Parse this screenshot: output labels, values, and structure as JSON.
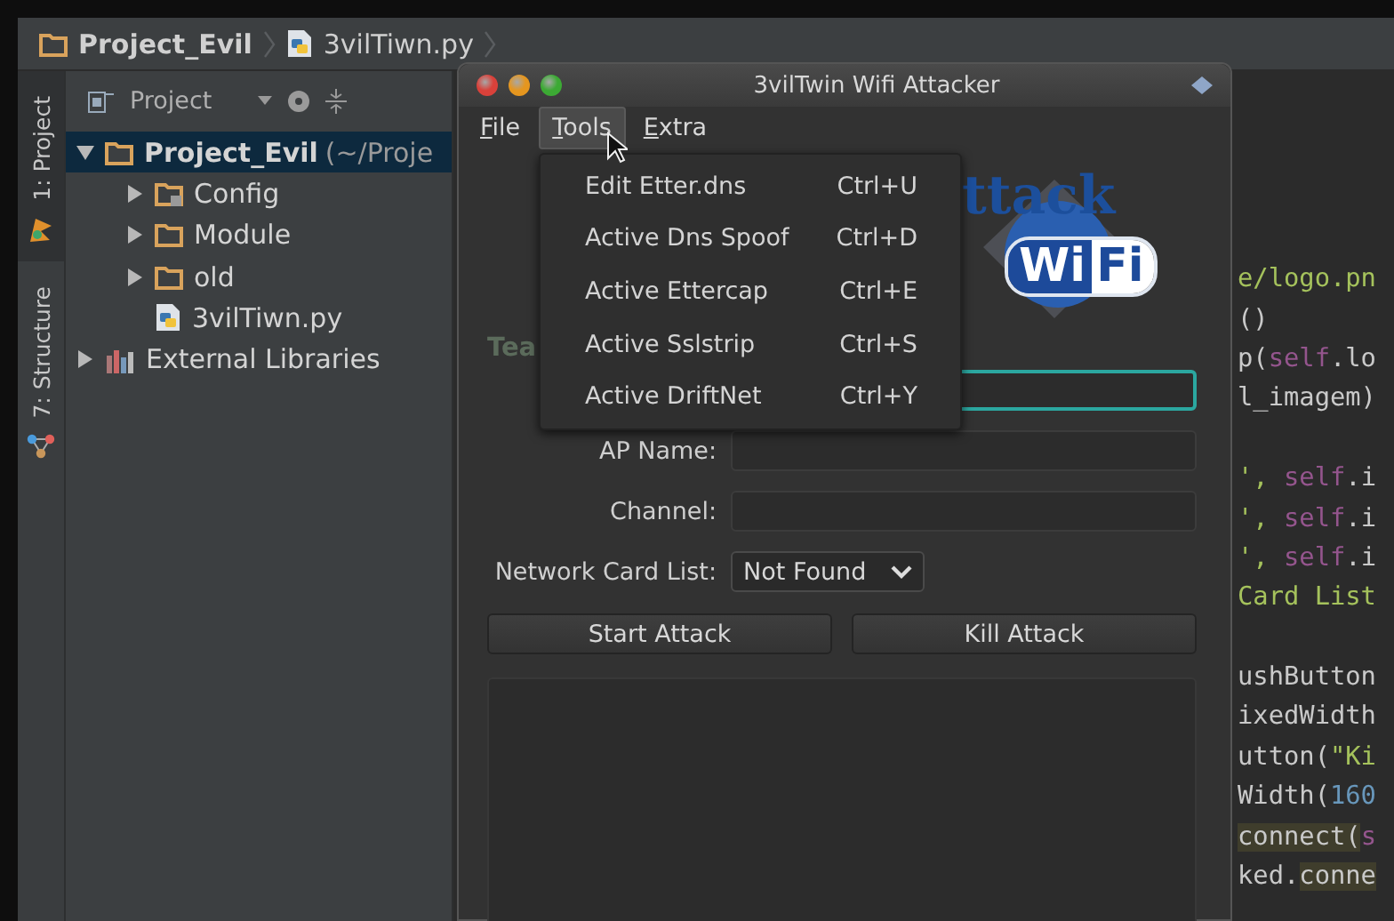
{
  "breadcrumb": [
    {
      "label": "Project_Evil",
      "kind": "folder"
    },
    {
      "label": "3vilTiwn.py",
      "kind": "python"
    }
  ],
  "tool_rail": [
    {
      "label": "1: Project",
      "kind": "project",
      "selected": true
    },
    {
      "label": "7: Structure",
      "kind": "structure",
      "selected": false
    }
  ],
  "project_panel": {
    "title": "Project",
    "tree": [
      {
        "label": "Project_Evil",
        "path": "(~/Proje",
        "kind": "folder",
        "expanded": true,
        "selected": true,
        "children": [
          {
            "label": "Config",
            "kind": "config",
            "expanded": false,
            "selected": false
          },
          {
            "label": "Module",
            "kind": "folder",
            "expanded": false,
            "selected": false
          },
          {
            "label": "old",
            "kind": "folder",
            "expanded": false,
            "selected": false
          },
          {
            "label": "3vilTiwn.py",
            "kind": "python",
            "selected": false
          }
        ]
      },
      {
        "label": "External Libraries",
        "kind": "libraries",
        "expanded": false,
        "selected": false
      }
    ]
  },
  "code_blocks": [
    [
      [
        {
          "text": "e/logo.pn",
          "kind": "string"
        }
      ],
      [
        {
          "text": "()",
          "kind": "plain"
        }
      ],
      [
        {
          "text": "p(",
          "kind": "plain"
        },
        {
          "text": "self",
          "kind": "self"
        },
        {
          "text": ".lo",
          "kind": "plain"
        }
      ],
      [
        {
          "text": "l_imagem)",
          "kind": "plain"
        }
      ]
    ],
    [
      [
        {
          "text": "', ",
          "kind": "string"
        },
        {
          "text": "self",
          "kind": "self"
        },
        {
          "text": ".i",
          "kind": "plain"
        }
      ],
      [
        {
          "text": "', ",
          "kind": "string"
        },
        {
          "text": "self",
          "kind": "self"
        },
        {
          "text": ".i",
          "kind": "plain"
        }
      ],
      [
        {
          "text": "', ",
          "kind": "string"
        },
        {
          "text": "self",
          "kind": "self"
        },
        {
          "text": ".i",
          "kind": "plain"
        }
      ],
      [
        {
          "text": "Card List",
          "kind": "string"
        }
      ]
    ],
    [
      [
        {
          "text": "ushButton",
          "kind": "plain"
        }
      ],
      [
        {
          "text": "ixedWidth",
          "kind": "plain"
        }
      ],
      [
        {
          "text": "utton(",
          "kind": "plain"
        },
        {
          "text": "\"Ki",
          "kind": "string"
        }
      ],
      [
        {
          "text": "Width(",
          "kind": "plain"
        },
        {
          "text": "160",
          "kind": "number"
        }
      ],
      [
        {
          "text": "connect(",
          "kind": "highlight"
        },
        {
          "text": "s",
          "kind": "self"
        }
      ],
      [
        {
          "text": "ked.",
          "kind": "plain"
        },
        {
          "text": "conne",
          "kind": "highlight"
        }
      ]
    ]
  ],
  "dialog": {
    "title": "3vilTwin Wifi Attacker",
    "menus": [
      {
        "label": "File",
        "open": false
      },
      {
        "label": "Tools",
        "open": true
      },
      {
        "label": "Extra",
        "open": false
      }
    ],
    "logo": {
      "word": "ttack",
      "badge_left": "Wi",
      "badge_right": "Fi"
    },
    "section_label": "Tea",
    "fields": [
      {
        "focused": true
      },
      {
        "label": "AP Name:",
        "focused": false
      },
      {
        "label": "Channel:",
        "focused": false
      }
    ],
    "network_card": {
      "label": "Network Card List:",
      "value": "Not Found"
    },
    "buttons": [
      "Start Attack",
      "Kill Attack"
    ],
    "menu_items": [
      {
        "label": "Edit Etter.dns",
        "shortcut": "Ctrl+U"
      },
      {
        "label": "Active Dns Spoof",
        "shortcut": "Ctrl+D"
      },
      {
        "label": "Active Ettercap",
        "shortcut": "Ctrl+E"
      },
      {
        "label": "Active Sslstrip",
        "shortcut": "Ctrl+S"
      },
      {
        "label": "Active DriftNet",
        "shortcut": "Ctrl+Y"
      }
    ]
  }
}
